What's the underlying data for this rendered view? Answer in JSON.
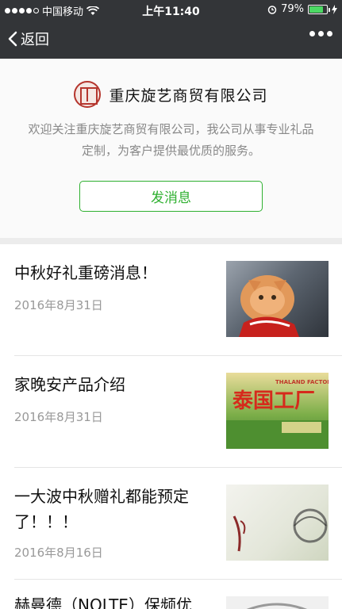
{
  "status_bar": {
    "carrier": "中国移动",
    "time": "上午11:40",
    "battery_percent": "79%",
    "battery_level": 0.79
  },
  "nav": {
    "back_label": "返回"
  },
  "profile": {
    "name": "重庆旋艺商贸有限公司",
    "description": "欢迎关注重庆旋艺商贸有限公司，我公司从事专业礼品定制，为客户提供最优质的服务。",
    "message_button": "发消息"
  },
  "articles": [
    {
      "title": "中秋好礼重磅消息！",
      "date": "2016年8月31日"
    },
    {
      "title": "家晚安产品介绍",
      "date": "2016年8月31日"
    },
    {
      "title": "一大波中秋赠礼都能预定了！！！",
      "date": "2016年8月16日"
    },
    {
      "title": "赫曼德（NOLTE）保频优"
    }
  ],
  "thumbnails": {
    "thai_text": "THALAND FACTORY",
    "thai_big": "泰国工厂"
  },
  "colors": {
    "header": "#333538",
    "accent_green": "#2fb030",
    "battery_green": "#4cd964"
  }
}
